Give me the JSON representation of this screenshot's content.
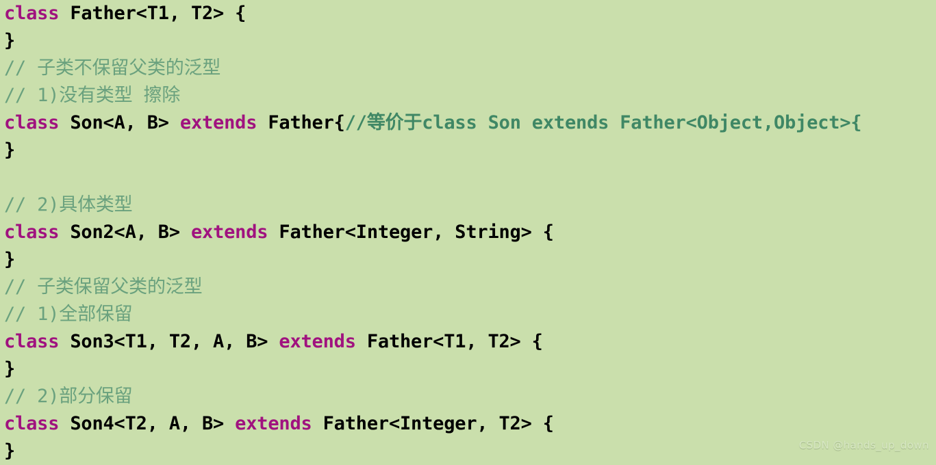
{
  "editor": {
    "background_color": "#cadfac",
    "language": "java",
    "colors": {
      "keyword": "#a0127f",
      "plain": "#000000",
      "comment": "#6aa17e",
      "comment_strong": "#3f8765"
    },
    "lines": [
      {
        "index": 1,
        "text": "class Father<T1, T2> {",
        "tokens": [
          {
            "t": "class",
            "k": "kw"
          },
          {
            "t": " Father<T1, T2> {",
            "k": "plain"
          }
        ]
      },
      {
        "index": 2,
        "text": "}",
        "tokens": [
          {
            "t": "}",
            "k": "plain"
          }
        ]
      },
      {
        "index": 3,
        "text": "// 子类不保留父类的泛型",
        "tokens": [
          {
            "t": "// 子类不保留父类的泛型",
            "k": "comment"
          }
        ]
      },
      {
        "index": 4,
        "text": "// 1)没有类型 擦除",
        "tokens": [
          {
            "t": "// 1)没有类型 擦除",
            "k": "comment"
          }
        ]
      },
      {
        "index": 5,
        "text": "class Son<A, B> extends Father{//等价于class Son extends Father<Object,Object>{",
        "tokens": [
          {
            "t": "class",
            "k": "kw"
          },
          {
            "t": " Son<A, B> ",
            "k": "plain"
          },
          {
            "t": "extends",
            "k": "kw"
          },
          {
            "t": " Father{",
            "k": "plain"
          },
          {
            "t": "//等价于",
            "k": "comment_strong"
          },
          {
            "t": "class Son extends Father<Object,Object>{",
            "k": "comment_strong"
          }
        ]
      },
      {
        "index": 6,
        "text": "}",
        "tokens": [
          {
            "t": "}",
            "k": "plain"
          }
        ]
      },
      {
        "index": 7,
        "text": "",
        "tokens": []
      },
      {
        "index": 8,
        "text": "// 2)具体类型",
        "tokens": [
          {
            "t": "// 2)具体类型",
            "k": "comment"
          }
        ]
      },
      {
        "index": 9,
        "text": "class Son2<A, B> extends Father<Integer, String> {",
        "tokens": [
          {
            "t": "class",
            "k": "kw"
          },
          {
            "t": " Son2<A, B> ",
            "k": "plain"
          },
          {
            "t": "extends",
            "k": "kw"
          },
          {
            "t": " Father<Integer, String> {",
            "k": "plain"
          }
        ]
      },
      {
        "index": 10,
        "text": "}",
        "tokens": [
          {
            "t": "}",
            "k": "plain"
          }
        ]
      },
      {
        "index": 11,
        "text": "// 子类保留父类的泛型",
        "tokens": [
          {
            "t": "// 子类保留父类的泛型",
            "k": "comment"
          }
        ]
      },
      {
        "index": 12,
        "text": "// 1)全部保留",
        "tokens": [
          {
            "t": "// 1)全部保留",
            "k": "comment"
          }
        ]
      },
      {
        "index": 13,
        "text": "class Son3<T1, T2, A, B> extends Father<T1, T2> {",
        "tokens": [
          {
            "t": "class",
            "k": "kw"
          },
          {
            "t": " Son3<T1, T2, A, B> ",
            "k": "plain"
          },
          {
            "t": "extends",
            "k": "kw"
          },
          {
            "t": " Father<T1, T2> {",
            "k": "plain"
          }
        ]
      },
      {
        "index": 14,
        "text": "}",
        "tokens": [
          {
            "t": "}",
            "k": "plain"
          }
        ]
      },
      {
        "index": 15,
        "text": "// 2)部分保留",
        "tokens": [
          {
            "t": "// 2)部分保留",
            "k": "comment"
          }
        ]
      },
      {
        "index": 16,
        "text": "class Son4<T2, A, B> extends Father<Integer, T2> {",
        "tokens": [
          {
            "t": "class",
            "k": "kw"
          },
          {
            "t": " Son4<T2, A, B> ",
            "k": "plain"
          },
          {
            "t": "extends",
            "k": "kw"
          },
          {
            "t": " Father<Integer, T2> {",
            "k": "plain"
          }
        ]
      },
      {
        "index": 17,
        "text": "}",
        "tokens": [
          {
            "t": "}",
            "k": "plain"
          }
        ]
      }
    ]
  },
  "watermark": {
    "text": "CSDN @hands_up_down"
  }
}
